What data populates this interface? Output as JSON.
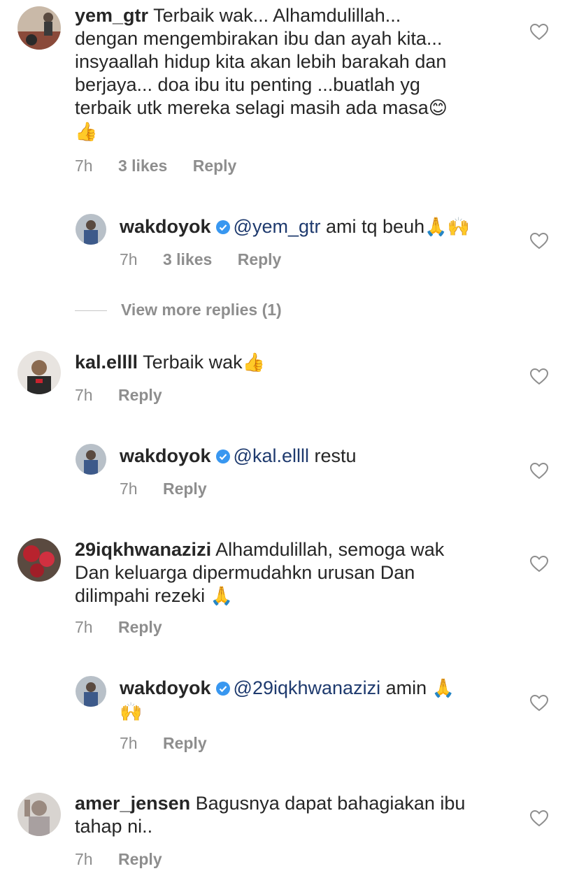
{
  "comments": [
    {
      "username": "yem_gtr",
      "text_lines": [
        "Terbaik wak... Alhamdulillah...",
        "dengan mengembirakan ibu dan ayah kita...",
        "insyaallah hidup kita akan lebih barakah dan",
        "berjaya... doa ibu itu penting ...buatlah yg",
        "terbaik utk mereka selagi masih ada masa"
      ],
      "emoji_inline": "😊",
      "emoji_line": "👍",
      "time": "7h",
      "likes": "3 likes",
      "reply": "Reply",
      "avatar_color": "#8a4a3a"
    },
    {
      "username": "wakdoyok",
      "mention": "@yem_gtr",
      "text": "ami tq beuh",
      "emoji": "🙏🙌",
      "time": "7h",
      "likes": "3 likes",
      "reply": "Reply",
      "avatar_color": "#3d5a8a"
    },
    {
      "view_more": "View more replies (1)"
    },
    {
      "username": "kal.ellll",
      "text": "Terbaik wak",
      "emoji": "👍",
      "time": "7h",
      "reply": "Reply",
      "avatar_color": "#2a2a2a"
    },
    {
      "username": "wakdoyok",
      "mention": "@kal.ellll",
      "text": "restu",
      "time": "7h",
      "reply": "Reply",
      "avatar_color": "#3d5a8a"
    },
    {
      "username": "29iqkhwanazizi",
      "text_lines": [
        "Alhamdulillah, semoga wak",
        "Dan keluarga dipermudahkn urusan Dan",
        "dilimpahi rezeki"
      ],
      "emoji": "🙏",
      "time": "7h",
      "reply": "Reply",
      "avatar_color": "#b8232e"
    },
    {
      "username": "wakdoyok",
      "mention": "@29iqkhwanazizi",
      "text": "amin",
      "emoji": "🙏",
      "emoji_line": "🙌",
      "time": "7h",
      "reply": "Reply",
      "avatar_color": "#3d5a8a"
    },
    {
      "username": "amer_jensen",
      "text_lines": [
        "Bagusnya dapat bahagiakan ibu",
        "tahap ni.."
      ],
      "time": "7h",
      "reply": "Reply",
      "avatar_color": "#9a8a80"
    }
  ],
  "colors": {
    "mention": "#1e3a6e",
    "meta": "#8e8e8e",
    "verified": "#3897f0"
  }
}
